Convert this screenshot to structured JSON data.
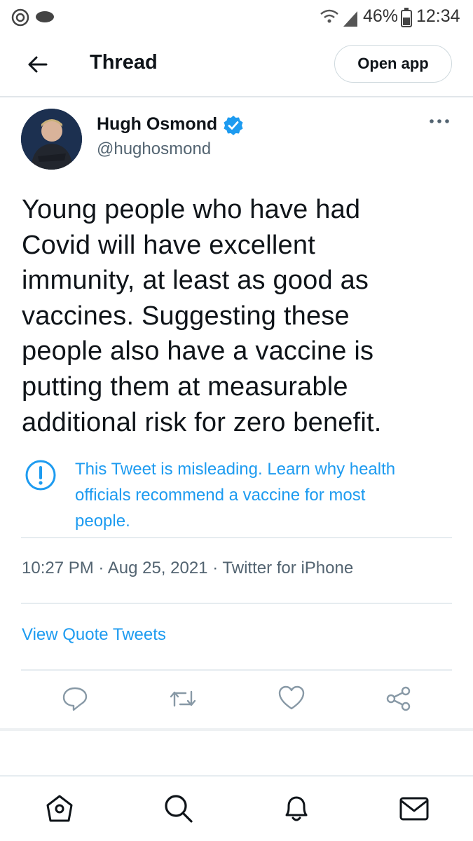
{
  "status_bar": {
    "battery": "46%",
    "time": "12:34"
  },
  "header": {
    "title": "Thread",
    "open_app_label": "Open app"
  },
  "tweet": {
    "author_name": "Hugh Osmond",
    "author_handle": "@hughosmond",
    "text_lines": [
      "Young people who have had",
      "Covid will have excellent",
      "immunity, at least as good as",
      "vaccines. Suggesting these",
      "people also have a vaccine is",
      "putting them at measurable",
      "additional risk for zero benefit."
    ],
    "notice_lines": [
      "This Tweet is misleading. Learn why health",
      "officials recommend a vaccine for most",
      "people."
    ],
    "meta": "10:27 PM · Aug 25, 2021 · Twitter for iPhone",
    "view_quote_tweets": "View Quote Tweets"
  },
  "colors": {
    "accent": "#1d9bf0",
    "verified": "#1d9bf0",
    "secondary_text": "#536471"
  },
  "icons": [
    "back-arrow-icon",
    "verified-badge-icon",
    "more-options-icon",
    "alert-icon",
    "reply-icon",
    "retweet-icon",
    "like-icon",
    "share-icon",
    "home-icon",
    "search-icon",
    "notifications-icon",
    "messages-icon"
  ]
}
